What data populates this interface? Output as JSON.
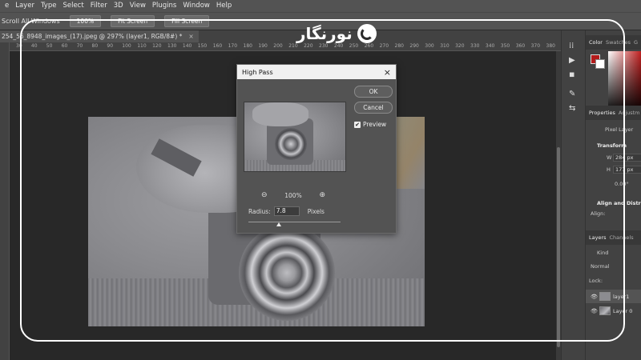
{
  "menubar": {
    "items": [
      "e",
      "Layer",
      "Type",
      "Select",
      "Filter",
      "3D",
      "View",
      "Plugins",
      "Window",
      "Help"
    ]
  },
  "options_bar": {
    "scroll_all": "Scroll All Windows",
    "zoom_btn": "100%",
    "fit_btn": "Fit Screen",
    "fill_btn": "Fill Screen"
  },
  "document_tab": {
    "title": "254_56_8948_images_(17).jpeg @ 297% (layer1, RGB/8#) *",
    "close": "×"
  },
  "ruler": {
    "labels": [
      "30",
      "40",
      "50",
      "60",
      "70",
      "80",
      "90",
      "100",
      "110",
      "120",
      "130",
      "140",
      "150",
      "160",
      "170",
      "180",
      "190",
      "200",
      "210",
      "220",
      "230",
      "240",
      "250",
      "260",
      "270",
      "280",
      "290",
      "300",
      "310",
      "320",
      "330",
      "340",
      "350",
      "360",
      "370",
      "380"
    ]
  },
  "watermark": {
    "text": "نورنگار"
  },
  "dialog": {
    "title": "High Pass",
    "close": "×",
    "ok_label": "OK",
    "cancel_label": "Cancel",
    "preview_label": "Preview",
    "preview_checked": "✔",
    "zoom_out": "⊖",
    "zoom_in": "⊕",
    "zoom_value": "100%",
    "radius_label": "Radius:",
    "radius_value": "7.8",
    "radius_unit": "Pixels"
  },
  "tools": {
    "icons": [
      "⁞⁞",
      "▶",
      "◾",
      "✎",
      "⇆"
    ]
  },
  "panel": {
    "color_tabs": [
      "Color",
      "Swatches",
      "G"
    ],
    "properties_tabs": [
      "Properties",
      "Adjustm"
    ],
    "pixel_layer": "Pixel Layer",
    "transform": "Transform",
    "w_label": "W",
    "w_value": "284 px",
    "h_label": "H",
    "h_value": "177 px",
    "angle_value": "0.00°",
    "align_head": "Align and Distribu",
    "align_sub": "Align:",
    "layers_tabs": [
      "Layers",
      "Channels"
    ],
    "kind": "Kind",
    "blend": "Normal",
    "lock": "Lock:",
    "layers": [
      {
        "name": "layer1",
        "eye": "👁"
      },
      {
        "name": "Layer 0",
        "eye": "👁"
      }
    ]
  },
  "colors": {
    "foreground": "#b31b1b",
    "background": "#ffffff"
  }
}
